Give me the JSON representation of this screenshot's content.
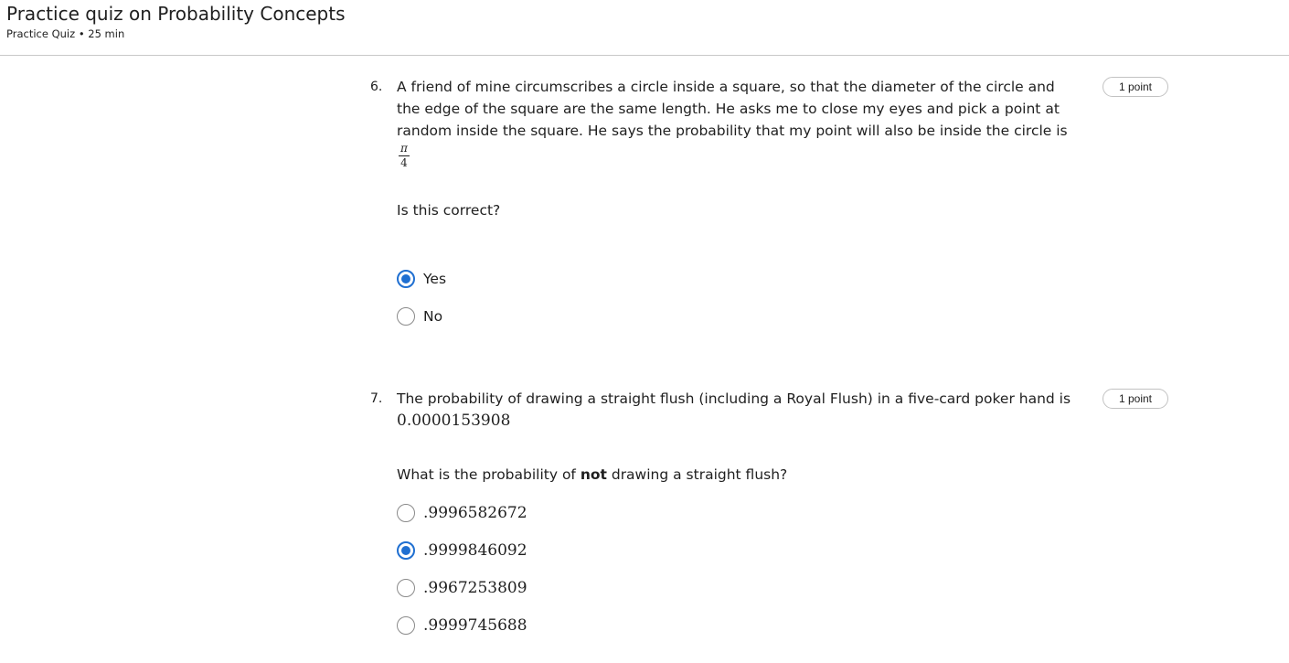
{
  "header": {
    "title": "Practice quiz on Probability Concepts",
    "meta": "Practice Quiz • 25 min"
  },
  "questions": [
    {
      "number": "6.",
      "points": "1 point",
      "text_lines": [
        "A friend of mine circumscribes a circle inside a square, so that the diameter of the circle and",
        "the edge of the square are the same length. He asks me to close my eyes and pick a point at",
        "random inside the square. He says the probability that my point will also be inside the circle is"
      ],
      "fraction": {
        "numerator": "π",
        "denominator": "4"
      },
      "prompt": "Is this correct?",
      "options": [
        {
          "label": "Yes",
          "selected": true
        },
        {
          "label": "No",
          "selected": false
        }
      ]
    },
    {
      "number": "7.",
      "points": "1 point",
      "text_line": "The probability of drawing a straight flush (including a Royal Flush) in a five-card poker hand is",
      "value": "0.0000153908",
      "prompt_before": "What is the probability of ",
      "prompt_bold": "not",
      "prompt_after": " drawing a straight flush?",
      "options": [
        {
          "label": ".9996582672",
          "selected": false
        },
        {
          "label": ".9999846092",
          "selected": true
        },
        {
          "label": ".9967253809",
          "selected": false
        },
        {
          "label": ".9999745688",
          "selected": false
        }
      ]
    }
  ],
  "colors": {
    "accent": "#1f6fd1",
    "divider": "#c9c9c9"
  }
}
